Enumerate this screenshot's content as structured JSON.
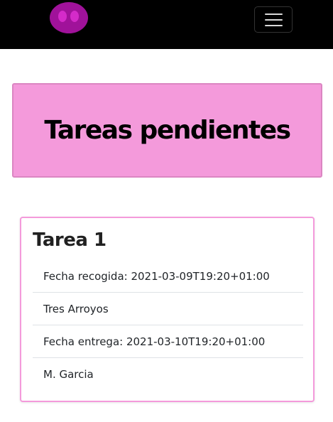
{
  "navbar": {
    "logo_icon": "pig-nose-icon",
    "toggler_icon": "hamburger-menu-icon",
    "colors": {
      "background": "#000000",
      "logo": "#a0129a"
    }
  },
  "hero": {
    "title": "Tareas pendientes",
    "background": "#f49adb"
  },
  "task_card": {
    "title": "Tarea 1",
    "items": [
      "Fecha recogida: 2021-03-09T19:20+01:00",
      "Tres Arroyos",
      "Fecha entrega: 2021-03-10T19:20+01:00",
      "M. Garcia"
    ],
    "border_color": "#f49adb"
  }
}
